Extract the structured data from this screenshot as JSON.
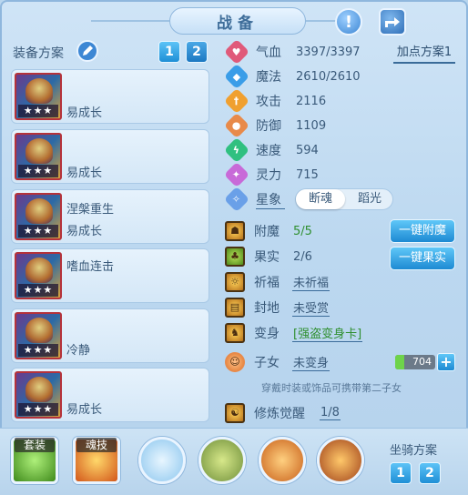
{
  "header": {
    "title": "战备"
  },
  "scheme": {
    "label": "装备方案",
    "tabs": [
      "1",
      "2"
    ],
    "cards": [
      {
        "name": "易成长",
        "stars": "★★★"
      },
      {
        "name": "易成长",
        "stars": "★★★"
      },
      {
        "name": "涅槃重生",
        "name2": "易成长",
        "stars": "★★★"
      },
      {
        "name": "嗜血连击",
        "stars": "★★★"
      },
      {
        "name": "冷静",
        "stars": "★★★"
      },
      {
        "name": "易成长",
        "stars": "★★★"
      }
    ]
  },
  "stats": {
    "plan_button": "加点方案1",
    "items": [
      {
        "name": "气血",
        "value": "3397/3397",
        "color": "#e05a7a"
      },
      {
        "name": "魔法",
        "value": "2610/2610",
        "color": "#3a9de8"
      },
      {
        "name": "攻击",
        "value": "2116",
        "color": "#f0a030"
      },
      {
        "name": "防御",
        "value": "1109",
        "color": "#e88a4a"
      },
      {
        "name": "速度",
        "value": "594",
        "color": "#30c080"
      },
      {
        "name": "灵力",
        "value": "715",
        "color": "#c86ad8"
      }
    ],
    "star_image": {
      "name": "星象",
      "options": [
        "断魂",
        "蹈光"
      ],
      "selected": "断魂"
    }
  },
  "features": {
    "enchant": {
      "name": "附魔",
      "value": "5/5"
    },
    "fruit": {
      "name": "果实",
      "value": "2/6"
    },
    "blessing": {
      "name": "祈福",
      "value": "未祈福"
    },
    "fief": {
      "name": "封地",
      "value": "未受赏"
    },
    "transform": {
      "name": "变身",
      "value": "[强盗变身卡]"
    },
    "child": {
      "name": "子女",
      "value": "未变身",
      "bar_value": "704"
    },
    "hint": "穿戴时装或饰品可携带第二子女",
    "awaken": {
      "name": "修炼觉醒",
      "value": "1/8"
    },
    "one_key_enchant": "一键附魔",
    "one_key_fruit": "一键果实"
  },
  "bottom": {
    "tags": [
      "套装",
      "魂技"
    ],
    "mount_label": "坐骑方案",
    "mount_tabs": [
      "1",
      "2"
    ]
  }
}
